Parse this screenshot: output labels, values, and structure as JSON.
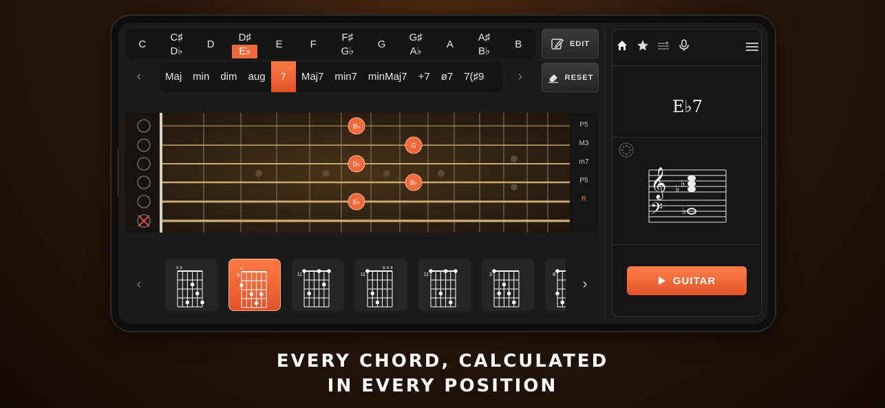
{
  "notes": [
    {
      "sharp": "C",
      "flat": null
    },
    {
      "sharp": "C♯",
      "flat": "D♭"
    },
    {
      "sharp": "D",
      "flat": null
    },
    {
      "sharp": "D♯",
      "flat": "E♭",
      "selected_flat": true
    },
    {
      "sharp": "E",
      "flat": null
    },
    {
      "sharp": "F",
      "flat": null
    },
    {
      "sharp": "F♯",
      "flat": "G♭"
    },
    {
      "sharp": "G",
      "flat": null
    },
    {
      "sharp": "G♯",
      "flat": "A♭"
    },
    {
      "sharp": "A",
      "flat": null
    },
    {
      "sharp": "A♯",
      "flat": "B♭"
    },
    {
      "sharp": "B",
      "flat": null
    }
  ],
  "qualities": [
    "Maj",
    "min",
    "dim",
    "aug",
    "7",
    "Maj7",
    "min7",
    "minMaj7",
    "+7",
    "ø7",
    "7(♯9"
  ],
  "active_quality": "7",
  "toolbar": {
    "edit_label": "EDIT",
    "reset_label": "RESET"
  },
  "intervals": [
    "P5",
    "M3",
    "m7",
    "P5",
    "R"
  ],
  "fret_notes": [
    "B♭",
    "G",
    "D♭",
    "B♭",
    "E♭"
  ],
  "chord_name": "E♭7",
  "play_label": "GUITAR",
  "caption": {
    "line1": "EVERY CHORD, CALCULATED",
    "line2": "IN EVERY POSITION"
  },
  "voicings": [
    {
      "fret_label": "",
      "marks": "x x"
    },
    {
      "fret_label": "6",
      "marks": "x"
    },
    {
      "fret_label": "11",
      "marks": ""
    },
    {
      "fret_label": "11",
      "marks": "o x x"
    },
    {
      "fret_label": "11",
      "marks": ""
    },
    {
      "fret_label": "3",
      "marks": ""
    },
    {
      "fret_label": "8",
      "marks": ""
    }
  ],
  "colors": {
    "accent": "#f06a3c",
    "panel": "#141414",
    "string": "#c9a777"
  },
  "icons": [
    "home-icon",
    "star-icon",
    "list-icon",
    "mic-icon",
    "menu-icon",
    "pencil-icon",
    "eraser-icon",
    "play-icon",
    "chevron-left-icon",
    "chevron-right-icon",
    "mute-x-icon",
    "settings-wheel-icon"
  ]
}
